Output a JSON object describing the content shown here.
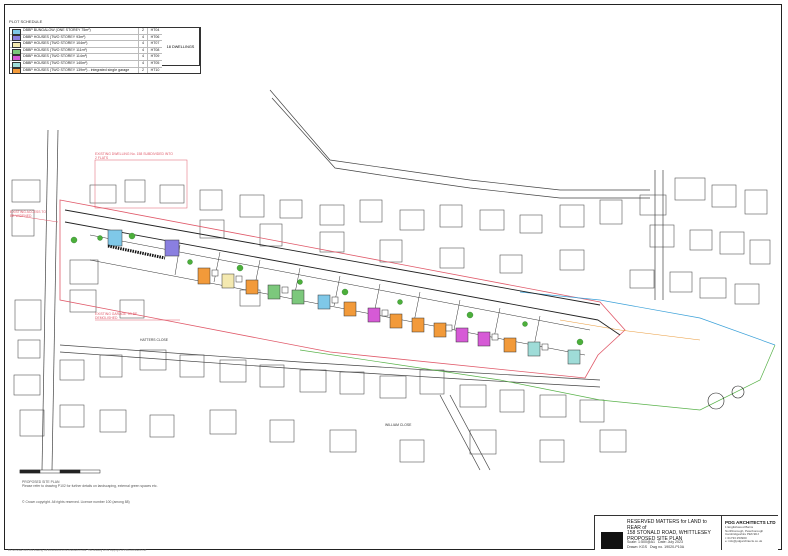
{
  "schedule": {
    "title": "PLOT SCHEDULE",
    "rows": [
      {
        "label": "DBBP BUNGALOW (ONE STOREY 75m²)",
        "count": "2",
        "type": "HT04",
        "color": "#7fc8e8"
      },
      {
        "label": "DBBP HOUSES (TWO STOREY 93m²)",
        "count": "4",
        "type": "HT06",
        "color": "#8a7fe0"
      },
      {
        "label": "DBBP HOUSES (TWO STOREY 104m²)",
        "count": "4",
        "type": "HT07",
        "color": "#f4e9b0"
      },
      {
        "label": "DBBP HOUSES (TWO STOREY 111m²)",
        "count": "4",
        "type": "HT08",
        "color": "#7cc87c"
      },
      {
        "label": "DBBP HOUSES (TWO STOREY 114m²)",
        "count": "4",
        "type": "HT09",
        "color": "#d65ad6"
      },
      {
        "label": "DBBP HOUSES (TWO STOREY 140m²)",
        "count": "4",
        "type": "HT05",
        "color": "#9fdcd8"
      },
      {
        "label": "DBBP HOUSES (TWO STOREY 139m²) - integrated single garage",
        "count": "2",
        "type": "HT10",
        "color": "#f29a3a"
      }
    ],
    "total": "18 DWELLINGS"
  },
  "annotations": {
    "existing_building": "EXISTING DWELLING No. 158 SUBDIVIDED INTO 2 FLATS",
    "existing_garage": "EXISTING GARAGE TO BE DEMOLISHED",
    "left_note": "EXISTING ACCESS TO BE WIDENED"
  },
  "road_labels": [
    "HATTERS CLOSE",
    "WILLIAM CLOSE"
  ],
  "notes": [
    "PROPOSED SITE PLAN",
    "Please refer to drawing P102 for further details on landscaping, external green spaces etc.",
    "© Crown copyright. All rights reserved. Licence number 100 (among 88)"
  ],
  "title_block": {
    "project_lines": [
      "RESERVED MATTERS for LAND to REAR of",
      "158 STONALD ROAD, WHITTLESEY",
      "PROPOSED SITE PLAN"
    ],
    "scale": "Scale: 1:500@A1",
    "date": "Date: July 2023",
    "drawn": "Drawn: KGS",
    "dwg": "Dwg no. 19020-P10A",
    "firm": "PDG ARCHITECTS LTD",
    "address": [
      "1 Englishwood Barns",
      "Northborough, Peterborough",
      "Cambridgeshire PE6 9DJ",
      "t: 01733 253900",
      "e: info@pdgarchitects.co.uk"
    ]
  },
  "footer": "Do not scale from this drawing. All dimensions to be checked on site. This drawing is the copyright of PDG Architects Ltd."
}
